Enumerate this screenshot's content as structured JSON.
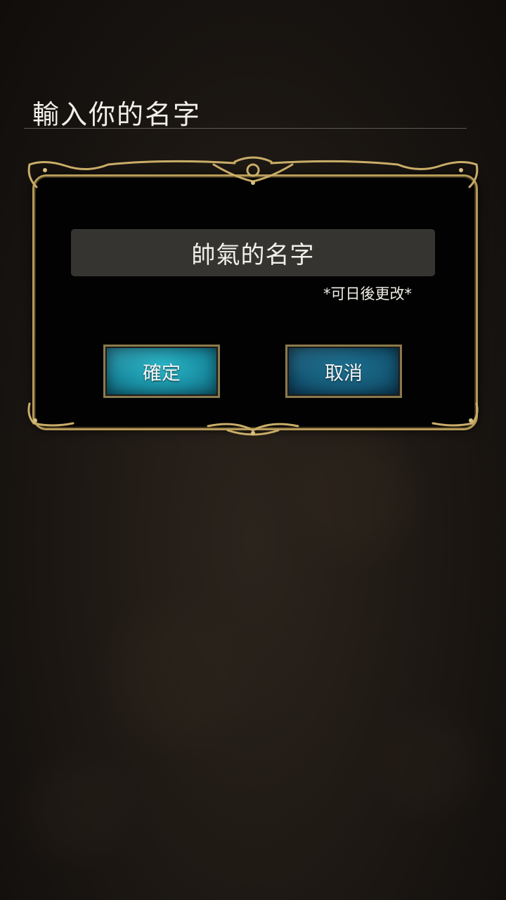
{
  "header": {
    "title": "輸入你的名字"
  },
  "dialog": {
    "name_value": "帥氣的名字",
    "hint": "*可日後更改*",
    "confirm_label": "確定",
    "cancel_label": "取消"
  },
  "colors": {
    "frame_gold": "#b59a57",
    "confirm_teal": "#1a8ea3",
    "cancel_blue": "#155a78",
    "input_bg": "#353430"
  }
}
